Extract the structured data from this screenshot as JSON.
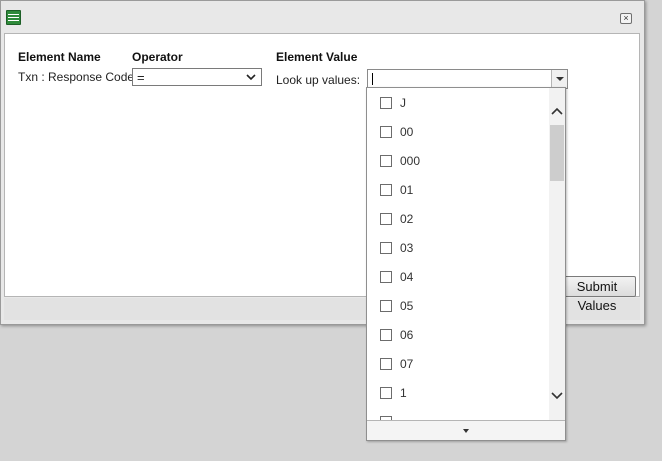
{
  "dialog": {
    "close_label": "×",
    "submit_label": "Submit Values"
  },
  "form": {
    "headers": {
      "element_name": "Element Name",
      "operator": "Operator",
      "element_value": "Element Value"
    },
    "element_name_value": "Txn : Response Code",
    "operator_value": "=",
    "lookup_label": "Look up values:",
    "lookup_input_value": ""
  },
  "lookup_list": {
    "items": [
      {
        "label": "J",
        "checked": false
      },
      {
        "label": "00",
        "checked": false
      },
      {
        "label": "000",
        "checked": false
      },
      {
        "label": "01",
        "checked": false
      },
      {
        "label": "02",
        "checked": false
      },
      {
        "label": "03",
        "checked": false
      },
      {
        "label": "04",
        "checked": false
      },
      {
        "label": "05",
        "checked": false
      },
      {
        "label": "06",
        "checked": false
      },
      {
        "label": "07",
        "checked": false
      },
      {
        "label": "1",
        "checked": false
      },
      {
        "label": "",
        "checked": false
      }
    ]
  },
  "colors": {
    "app_icon": "#2e8a3a",
    "background": "#d4d4d4",
    "panel": "#ffffff"
  },
  "icons": {
    "app": "list-document-icon",
    "close": "close-icon",
    "operator_dropdown": "chevron-down-icon",
    "lookup_dropdown": "caret-down-icon",
    "scroll_up": "chevron-up-icon",
    "scroll_down": "chevron-down-icon"
  }
}
